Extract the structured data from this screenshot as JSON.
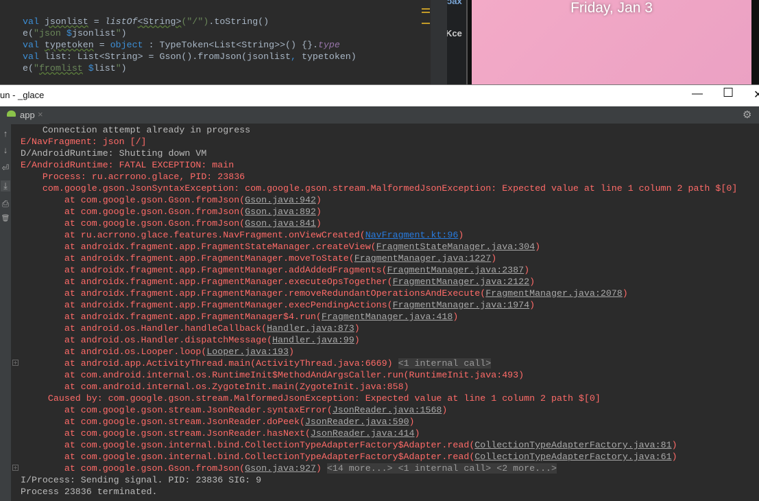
{
  "editor": {
    "lines": [
      [
        {
          "c": "kw",
          "t": "val "
        },
        {
          "c": "sq",
          "t": "jsonlist"
        },
        {
          "c": "",
          "t": " = "
        },
        {
          "c": "it",
          "t": "listOf"
        },
        {
          "c": "sq",
          "t": "<String>"
        },
        {
          "c": "str",
          "t": "(\"/\")"
        },
        {
          "c": "",
          "t": ".toString()"
        }
      ],
      [
        {
          "c": "",
          "t": "e("
        },
        {
          "c": "str",
          "t": "\"json "
        },
        {
          "c": "kw",
          "t": "$"
        },
        {
          "c": "",
          "t": "jsonlist"
        },
        {
          "c": "str",
          "t": "\""
        },
        {
          "c": "",
          "t": ")"
        }
      ],
      [
        {
          "c": "kw",
          "t": "val "
        },
        {
          "c": "sq",
          "t": "typetoken"
        },
        {
          "c": "",
          "t": " = "
        },
        {
          "c": "kw",
          "t": "object"
        },
        {
          "c": "",
          "t": " : TypeToken<List<String>>() {}."
        },
        {
          "c": "typ",
          "t": "type"
        }
      ],
      [
        {
          "c": "kw",
          "t": "val "
        },
        {
          "c": "",
          "t": "list: List<String> = Gson().fromJson(jsonlist"
        },
        {
          "c": "kw",
          "t": ","
        },
        {
          "c": "",
          "t": " typetoken)"
        }
      ],
      [
        {
          "c": "",
          "t": "e("
        },
        {
          "c": "str",
          "t": "\""
        },
        {
          "c": "str sq",
          "t": "fromlist"
        },
        {
          "c": "str",
          "t": " "
        },
        {
          "c": "kw",
          "t": "$"
        },
        {
          "c": "",
          "t": "list"
        },
        {
          "c": "str",
          "t": "\""
        },
        {
          "c": "",
          "t": ")"
        }
      ]
    ]
  },
  "side_panel": {
    "text1": "ɔax",
    "text2": "Kce"
  },
  "emulator": {
    "date": "Friday, Jan 3"
  },
  "window": {
    "title": "un - _glace",
    "minimize": "—",
    "maximize": "☐",
    "close": "✕"
  },
  "run_tab": {
    "label": "app",
    "close": "×",
    "settings": "⚙"
  },
  "toolbar": [
    "↑",
    "↓",
    "⏎",
    "⤓",
    "⎙",
    "🗑"
  ],
  "colors": {
    "error": "#ff6b68",
    "info": "#bbbbbb",
    "link_blue": "#287bde",
    "background": "#2b2b2b"
  },
  "console": [
    {
      "c": "info",
      "pre": "    Connection attempt already in progress"
    },
    {
      "c": "err",
      "pre": "E/NavFragment: json [/]"
    },
    {
      "c": "info",
      "pre": "D/AndroidRuntime: Shutting down VM"
    },
    {
      "c": "err",
      "pre": "E/AndroidRuntime: FATAL EXCEPTION: main"
    },
    {
      "c": "err",
      "pre": "    Process: ru.acrrono.glace, PID: 23836"
    },
    {
      "c": "err",
      "pre": "    com.google.gson.JsonSyntaxException: com.google.gson.stream.MalformedJsonException: Expected value at line 1 column 2 path $[0]"
    },
    {
      "c": "err",
      "pre": "        at com.google.gson.Gson.fromJson(",
      "link": "Gson.java:942",
      "post": ")"
    },
    {
      "c": "err",
      "pre": "        at com.google.gson.Gson.fromJson(",
      "link": "Gson.java:892",
      "post": ")"
    },
    {
      "c": "err",
      "pre": "        at com.google.gson.Gson.fromJson(",
      "link": "Gson.java:841",
      "post": ")"
    },
    {
      "c": "err",
      "pre": "        at ru.acrrono.glace.features.NavFragment.onViewCreated(",
      "link": "NavFragment.kt:96",
      "post": ")",
      "blue": true
    },
    {
      "c": "err",
      "pre": "        at androidx.fragment.app.FragmentStateManager.createView(",
      "link": "FragmentStateManager.java:304",
      "post": ")"
    },
    {
      "c": "err",
      "pre": "        at androidx.fragment.app.FragmentManager.moveToState(",
      "link": "FragmentManager.java:1227",
      "post": ")"
    },
    {
      "c": "err",
      "pre": "        at androidx.fragment.app.FragmentManager.addAddedFragments(",
      "link": "FragmentManager.java:2387",
      "post": ")"
    },
    {
      "c": "err",
      "pre": "        at androidx.fragment.app.FragmentManager.executeOpsTogether(",
      "link": "FragmentManager.java:2122",
      "post": ")"
    },
    {
      "c": "err",
      "pre": "        at androidx.fragment.app.FragmentManager.removeRedundantOperationsAndExecute(",
      "link": "FragmentManager.java:2078",
      "post": ")"
    },
    {
      "c": "err",
      "pre": "        at androidx.fragment.app.FragmentManager.execPendingActions(",
      "link": "FragmentManager.java:1974",
      "post": ")"
    },
    {
      "c": "err",
      "pre": "        at androidx.fragment.app.FragmentManager$4.run(",
      "link": "FragmentManager.java:418",
      "post": ")"
    },
    {
      "c": "err",
      "pre": "        at android.os.Handler.handleCallback(",
      "link": "Handler.java:873",
      "post": ")"
    },
    {
      "c": "err",
      "pre": "        at android.os.Handler.dispatchMessage(",
      "link": "Handler.java:99",
      "post": ")"
    },
    {
      "c": "err",
      "pre": "        at android.os.Looper.loop(",
      "link": "Looper.java:193",
      "post": ")"
    },
    {
      "c": "err",
      "pre": "        at android.app.ActivityThread.main(ActivityThread.java:6669)",
      "fold": "<1 internal call>",
      "expand": "+"
    },
    {
      "c": "err",
      "pre": "        at com.android.internal.os.RuntimeInit$MethodAndArgsCaller.run(RuntimeInit.java:493)"
    },
    {
      "c": "err",
      "pre": "        at com.android.internal.os.ZygoteInit.main(ZygoteInit.java:858)"
    },
    {
      "c": "err",
      "pre": "     Caused by: com.google.gson.stream.MalformedJsonException: Expected value at line 1 column 2 path $[0]"
    },
    {
      "c": "err",
      "pre": "        at com.google.gson.stream.JsonReader.syntaxError(",
      "link": "JsonReader.java:1568",
      "post": ")"
    },
    {
      "c": "err",
      "pre": "        at com.google.gson.stream.JsonReader.doPeek(",
      "link": "JsonReader.java:590",
      "post": ")"
    },
    {
      "c": "err",
      "pre": "        at com.google.gson.stream.JsonReader.hasNext(",
      "link": "JsonReader.java:414",
      "post": ")"
    },
    {
      "c": "err",
      "pre": "        at com.google.gson.internal.bind.CollectionTypeAdapterFactory$Adapter.read(",
      "link": "CollectionTypeAdapterFactory.java:81",
      "post": ")"
    },
    {
      "c": "err",
      "pre": "        at com.google.gson.internal.bind.CollectionTypeAdapterFactory$Adapter.read(",
      "link": "CollectionTypeAdapterFactory.java:61",
      "post": ")"
    },
    {
      "c": "err",
      "pre": "        at com.google.gson.Gson.fromJson(",
      "link": "Gson.java:927",
      "post": ")",
      "fold": "<14 more...> <1 internal call> <2 more...>",
      "expand": "+"
    },
    {
      "c": "info",
      "pre": "I/Process: Sending signal. PID: 23836 SIG: 9"
    },
    {
      "c": "info",
      "pre": "Process 23836 terminated."
    }
  ]
}
